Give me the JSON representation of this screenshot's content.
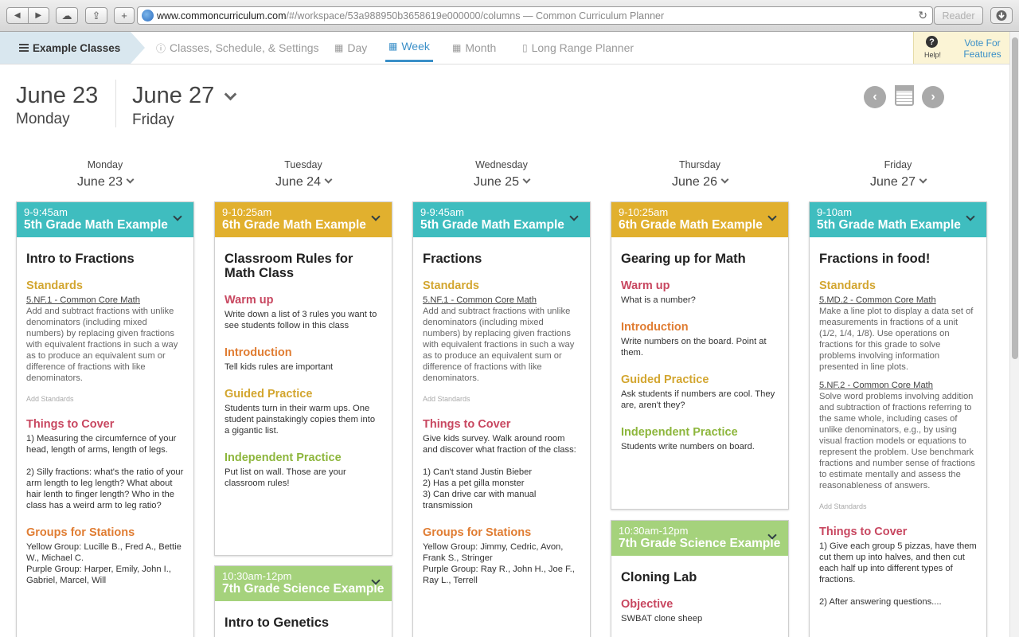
{
  "browser": {
    "url_host": "www.commoncurriculum.com",
    "url_path": "/#/workspace/53a988950b3658619e000000/columns",
    "page_title": "— Common Curriculum Planner",
    "reader_label": "Reader"
  },
  "nav": {
    "brand": "Example Classes",
    "items": [
      {
        "label": "Classes, Schedule, & Settings",
        "icon": "info-icon"
      },
      {
        "label": "Day",
        "icon": "calendar-icon"
      },
      {
        "label": "Week",
        "icon": "calendar-icon"
      },
      {
        "label": "Month",
        "icon": "calendar-icon"
      },
      {
        "label": "Long Range Planner",
        "icon": "document-icon"
      }
    ],
    "active": "Week",
    "help_label": "Help!",
    "vote_label": "Vote For Features"
  },
  "range": {
    "start_date": "June 23",
    "start_day": "Monday",
    "end_date": "June 27",
    "end_day": "Friday"
  },
  "colors": {
    "teal": "#3fbdbf",
    "gold": "#e1b02e",
    "green": "#a5d27c",
    "link_blue": "#3a8fc8"
  },
  "days": [
    {
      "name": "Monday",
      "date": "June 23",
      "cards": [
        {
          "time": "9-9:45am",
          "class": "5th Grade Math Example",
          "title": "Intro to Fractions",
          "standards": [
            {
              "code": "5.NF.1 - Common Core Math",
              "text": "Add and subtract fractions with unlike denominators (including mixed numbers) by replacing given fractions with equivalent fractions in such a way as to produce an equivalent sum or difference of fractions with like denominators."
            }
          ],
          "add_standards": "Add Standards",
          "sections": [
            {
              "heading": "Things to Cover",
              "text": "1) Measuring the circumfernce of your head, length of arms, length of legs.\n\n2) Silly fractions: what's the ratio of your arm length to leg length? What about hair lenth to finger length? Who in the class has a weird arm to leg ratio?"
            },
            {
              "heading": "Groups for Stations",
              "text": "Yellow Group: Lucille B., Fred A., Bettie W., Michael C.\nPurple Group: Harper, Emily, John I., Gabriel, Marcel, Will"
            }
          ]
        }
      ]
    },
    {
      "name": "Tuesday",
      "date": "June 24",
      "cards": [
        {
          "time": "9-10:25am",
          "class": "6th Grade Math Example",
          "title": "Classroom Rules for Math Class",
          "sections": [
            {
              "heading": "Warm up",
              "text": "Write down a list of 3 rules you want to see students follow in this class"
            },
            {
              "heading": "Introduction",
              "text": "Tell kids rules are important"
            },
            {
              "heading": "Guided Practice",
              "text": "Students turn in their warm ups. One student painstakingly copies them into a gigantic list."
            },
            {
              "heading": "Independent Practice",
              "text": "Put list on wall. Those are your classroom rules!"
            }
          ]
        },
        {
          "time": "10:30am-12pm",
          "class": "7th Grade Science Example",
          "title": "Intro to Genetics",
          "sections": []
        }
      ]
    },
    {
      "name": "Wednesday",
      "date": "June 25",
      "cards": [
        {
          "time": "9-9:45am",
          "class": "5th Grade Math Example",
          "title": "Fractions",
          "standards": [
            {
              "code": "5.NF.1 - Common Core Math",
              "text": "Add and subtract fractions with unlike denominators (including mixed numbers) by replacing given fractions with equivalent fractions in such a way as to produce an equivalent sum or difference of fractions with like denominators."
            }
          ],
          "add_standards": "Add Standards",
          "sections": [
            {
              "heading": "Things to Cover",
              "text": "Give kids survey. Walk around room and discover what fraction of the class:\n\n1) Can't stand Justin Bieber\n2) Has a pet gilla monster\n3) Can drive car with manual transmission"
            },
            {
              "heading": "Groups for Stations",
              "text": "Yellow Group: Jimmy, Cedric, Avon, Frank S., Stringer\nPurple Group: Ray R., John H., Joe F., Ray L., Terrell"
            }
          ]
        }
      ]
    },
    {
      "name": "Thursday",
      "date": "June 26",
      "cards": [
        {
          "time": "9-10:25am",
          "class": "6th Grade Math Example",
          "title": "Gearing up for Math",
          "sections": [
            {
              "heading": "Warm up",
              "text": "What is a number?"
            },
            {
              "heading": "Introduction",
              "text": "Write numbers on the board. Point at them."
            },
            {
              "heading": "Guided Practice",
              "text": "Ask students if numbers are cool. They are, aren't they?"
            },
            {
              "heading": "Independent Practice",
              "text": "Students write numbers on board."
            }
          ]
        },
        {
          "time": "10:30am-12pm",
          "class": "7th Grade Science Example",
          "title": "Cloning Lab",
          "sections": [
            {
              "heading": "Objective",
              "text": "SWBAT clone sheep"
            }
          ]
        }
      ]
    },
    {
      "name": "Friday",
      "date": "June 27",
      "cards": [
        {
          "time": "9-10am",
          "class": "5th Grade Math Example",
          "title": "Fractions in food!",
          "standards": [
            {
              "code": "5.MD.2 - Common Core Math",
              "text": "Make a line plot to display a data set of measurements in fractions of a unit (1/2, 1/4, 1/8). Use operations on fractions for this grade to solve problems involving information presented in line plots."
            },
            {
              "code": "5.NF.2 - Common Core Math",
              "text": "Solve word problems involving addition and subtraction of fractions referring to the same whole, including cases of unlike denominators, e.g., by using visual fraction models or equations to represent the problem. Use benchmark fractions and number sense of fractions to estimate mentally and assess the reasonableness of answers."
            }
          ],
          "add_standards": "Add Standards",
          "sections": [
            {
              "heading": "Things to Cover",
              "text": "1) Give each group 5 pizzas, have them cut them up into halves, and then cut each half up into different types of fractions.\n\n2) After answering questions...."
            }
          ]
        }
      ]
    }
  ]
}
